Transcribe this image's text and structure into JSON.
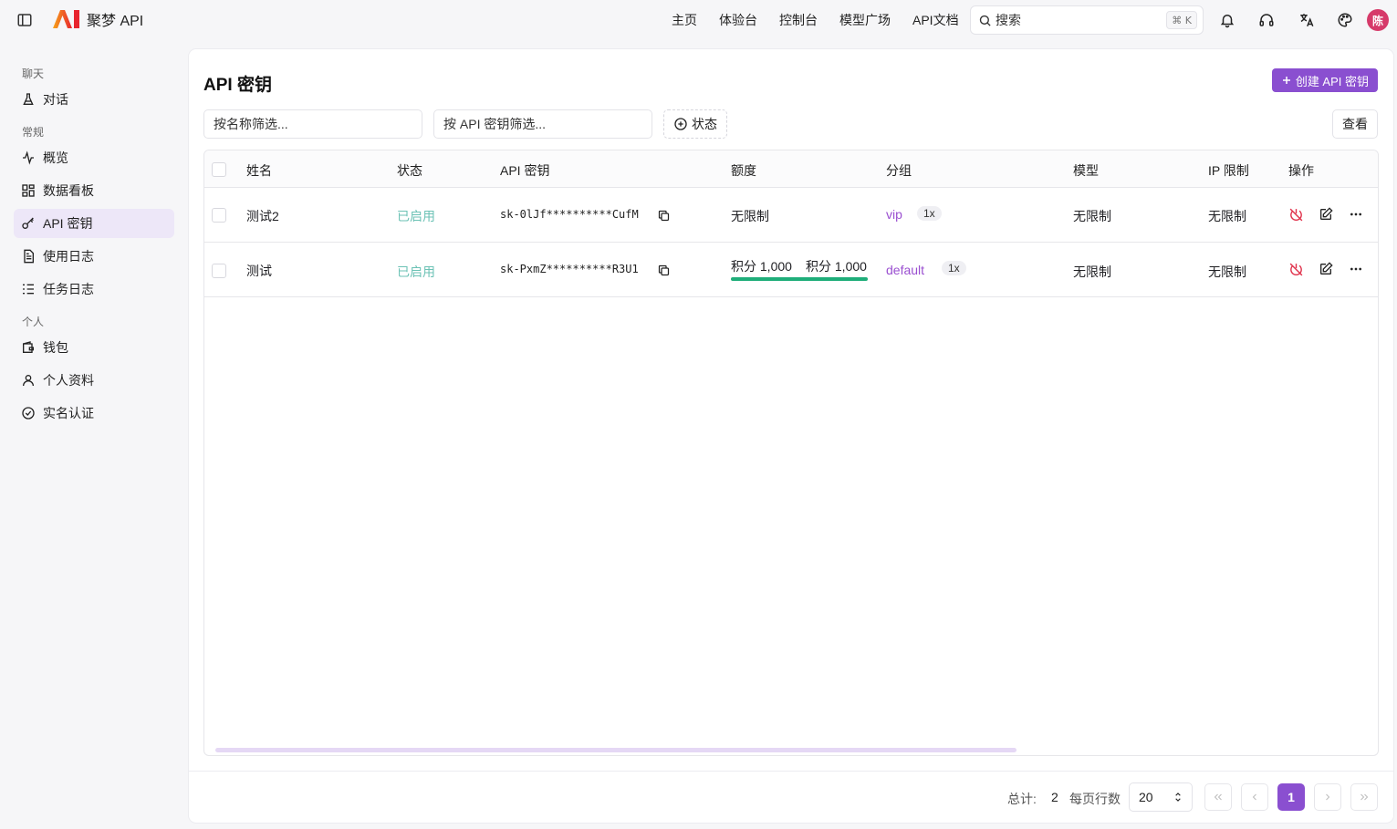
{
  "header": {
    "brand_name": "聚梦 API",
    "nav": [
      "主页",
      "体验台",
      "控制台",
      "模型广场",
      "API文档"
    ],
    "search_label": "搜索",
    "search_shortcut": "⌘ K",
    "avatar_initial": "陈"
  },
  "sidebar": {
    "groups": [
      {
        "title": "聊天",
        "items": [
          {
            "label": "对话",
            "icon": "flask-icon"
          }
        ]
      },
      {
        "title": "常规",
        "items": [
          {
            "label": "概览",
            "icon": "activity-icon"
          },
          {
            "label": "数据看板",
            "icon": "dashboard-icon"
          },
          {
            "label": "API 密钥",
            "icon": "key-icon",
            "active": true
          },
          {
            "label": "使用日志",
            "icon": "document-icon"
          },
          {
            "label": "任务日志",
            "icon": "list-icon"
          }
        ]
      },
      {
        "title": "个人",
        "items": [
          {
            "label": "钱包",
            "icon": "wallet-icon"
          },
          {
            "label": "个人资料",
            "icon": "user-icon"
          },
          {
            "label": "实名认证",
            "icon": "verify-icon"
          }
        ]
      }
    ]
  },
  "main": {
    "title": "API 密钥",
    "create_button": "创建 API 密钥",
    "filter_name_placeholder": "按名称筛选...",
    "filter_key_placeholder": "按 API 密钥筛选...",
    "status_filter": "状态",
    "view_button": "查看",
    "columns": [
      "姓名",
      "状态",
      "API 密钥",
      "额度",
      "分组",
      "模型",
      "IP 限制",
      "操作"
    ],
    "rows": [
      {
        "name": "测试2",
        "status": "已启用",
        "key": "sk-0lJf**********CufM",
        "quota": "无限制",
        "group": "vip",
        "ratio": "1x",
        "models": "无限制",
        "ip_limit": "无限制"
      },
      {
        "name": "测试",
        "status": "已启用",
        "key": "sk-PxmZ**********R3U1",
        "quota_used": "积分 1,000",
        "quota_total": "积分 1,000",
        "quota_fraction": 1.0,
        "group": "default",
        "ratio": "1x",
        "models": "无限制",
        "ip_limit": "无限制"
      }
    ]
  },
  "footer": {
    "total_label": "总计:",
    "total_value": "2",
    "rows_per_page_label": "每页行数",
    "rows_per_page": "20",
    "current_page": "1"
  },
  "colors": {
    "accent": "#8a4fd0",
    "status_enabled": "#6cc2b5",
    "quota_bar": "#1fae7a",
    "danger": "#e0314b"
  }
}
